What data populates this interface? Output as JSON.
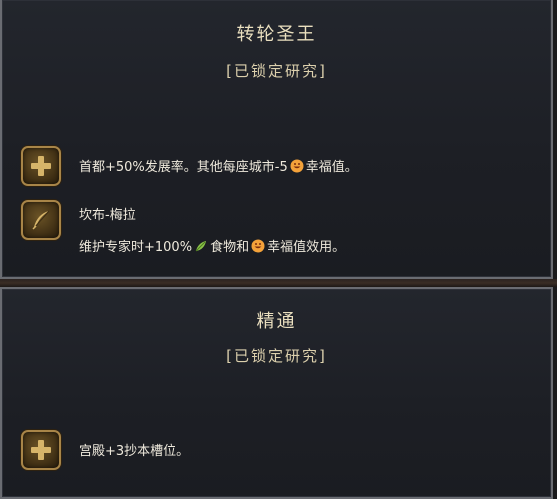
{
  "panels": [
    {
      "title": "转轮圣王",
      "subtitle": "[已锁定研究]",
      "rows": [
        {
          "icon": "plus-icon",
          "line1": {
            "pre": "首都+50%发展率。其他每座城市-5",
            "post": "幸福值。"
          }
        },
        {
          "icon": "quill-icon",
          "line1": {
            "text": "坎布-梅拉"
          },
          "line2": {
            "pre": "维护专家时+100%",
            "mid": "食物和",
            "post": "幸福值效用。"
          }
        }
      ]
    },
    {
      "title": "精通",
      "subtitle": "[已锁定研究]",
      "rows": [
        {
          "icon": "plus-icon",
          "line1": {
            "text": "宫殿+3抄本槽位。"
          }
        }
      ]
    }
  ],
  "colors": {
    "title": "#eadfbf",
    "text": "#eee9dc",
    "icon_gold": "#d6b469",
    "happiness": "#f4a23a",
    "food": "#8bc34a"
  }
}
